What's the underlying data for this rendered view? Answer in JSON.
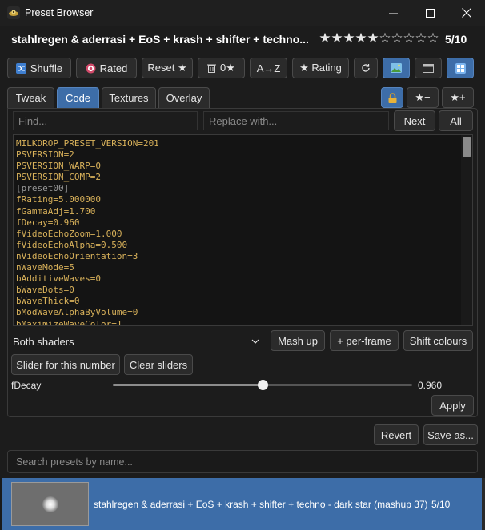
{
  "window": {
    "title": "Preset Browser",
    "controls": [
      "minimize-icon",
      "maximize-icon",
      "close-icon"
    ]
  },
  "header": {
    "preset_title": "stahlregen & aderrasi + EoS + krash + shifter + techno...",
    "stars_filled": 5,
    "stars_total": 10,
    "rating_text": "5/10"
  },
  "toolbar": {
    "shuffle": "Shuffle",
    "rated": "Rated",
    "reset": "Reset ★",
    "zero_star": "0★",
    "sort_az": "A→Z",
    "rating": "★ Rating"
  },
  "tabs": [
    {
      "label": "Tweak",
      "active": false
    },
    {
      "label": "Code",
      "active": true
    },
    {
      "label": "Textures",
      "active": false
    },
    {
      "label": "Overlay",
      "active": false
    }
  ],
  "tab_actions": {
    "star_minus": "★−",
    "star_plus": "★+"
  },
  "find": {
    "find_placeholder": "Find...",
    "replace_placeholder": "Replace with...",
    "next": "Next",
    "all": "All"
  },
  "code_lines": [
    "MILKDROP_PRESET_VERSION=201",
    "PSVERSION=2",
    "PSVERSION_WARP=0",
    "PSVERSION_COMP=2",
    "[preset00]",
    "fRating=5.000000",
    "fGammaAdj=1.700",
    "fDecay=0.960",
    "fVideoEchoZoom=1.000",
    "fVideoEchoAlpha=0.500",
    "nVideoEchoOrientation=3",
    "nWaveMode=5",
    "bAdditiveWaves=0",
    "bWaveDots=0",
    "bWaveThick=0",
    "bModWaveAlphaByVolume=0",
    "bMaximizeWaveColor=1"
  ],
  "shader_select": {
    "value": "Both shaders"
  },
  "actions": {
    "mash_up": "Mash up",
    "per_frame": "+ per-frame",
    "shift_colours": "Shift colours",
    "slider_for_number": "Slider for this number",
    "clear_sliders": "Clear sliders",
    "apply": "Apply",
    "revert": "Revert",
    "save_as": "Save as..."
  },
  "slider": {
    "label": "fDecay",
    "value": 0.96,
    "value_text": "0.960",
    "fraction": 0.5
  },
  "search": {
    "placeholder": "Search presets by name..."
  },
  "preset_list": [
    {
      "name": "stahlregen & aderrasi + EoS + krash + shifter + techno - dark star (mashup 37)",
      "rating": "5/10",
      "selected": true
    }
  ],
  "colors": {
    "accent": "#3d6da8",
    "background": "#1c1c1c",
    "code_text": "#d8b15a"
  }
}
